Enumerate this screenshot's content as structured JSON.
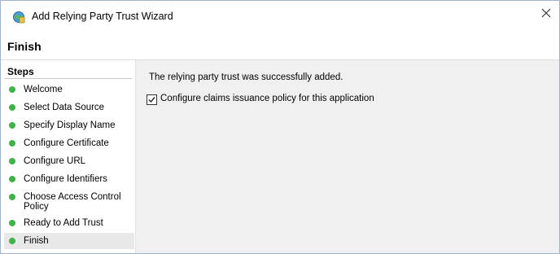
{
  "window": {
    "title": "Add Relying Party Trust Wizard",
    "close_glyph": "✕"
  },
  "page": {
    "title": "Finish"
  },
  "steps": {
    "header": "Steps",
    "items": [
      {
        "label": "Welcome",
        "status": "complete"
      },
      {
        "label": "Select Data Source",
        "status": "complete"
      },
      {
        "label": "Specify Display Name",
        "status": "complete"
      },
      {
        "label": "Configure Certificate",
        "status": "complete"
      },
      {
        "label": "Configure URL",
        "status": "complete"
      },
      {
        "label": "Configure Identifiers",
        "status": "complete"
      },
      {
        "label": "Choose Access Control Policy",
        "status": "complete"
      },
      {
        "label": "Ready to Add Trust",
        "status": "complete"
      },
      {
        "label": "Finish",
        "status": "current"
      }
    ],
    "dot_color": "#3fb24a"
  },
  "content": {
    "success_message": "The relying party trust was successfully added.",
    "configure_claims": {
      "label": "Configure claims issuance policy for this application",
      "checked": true
    }
  }
}
